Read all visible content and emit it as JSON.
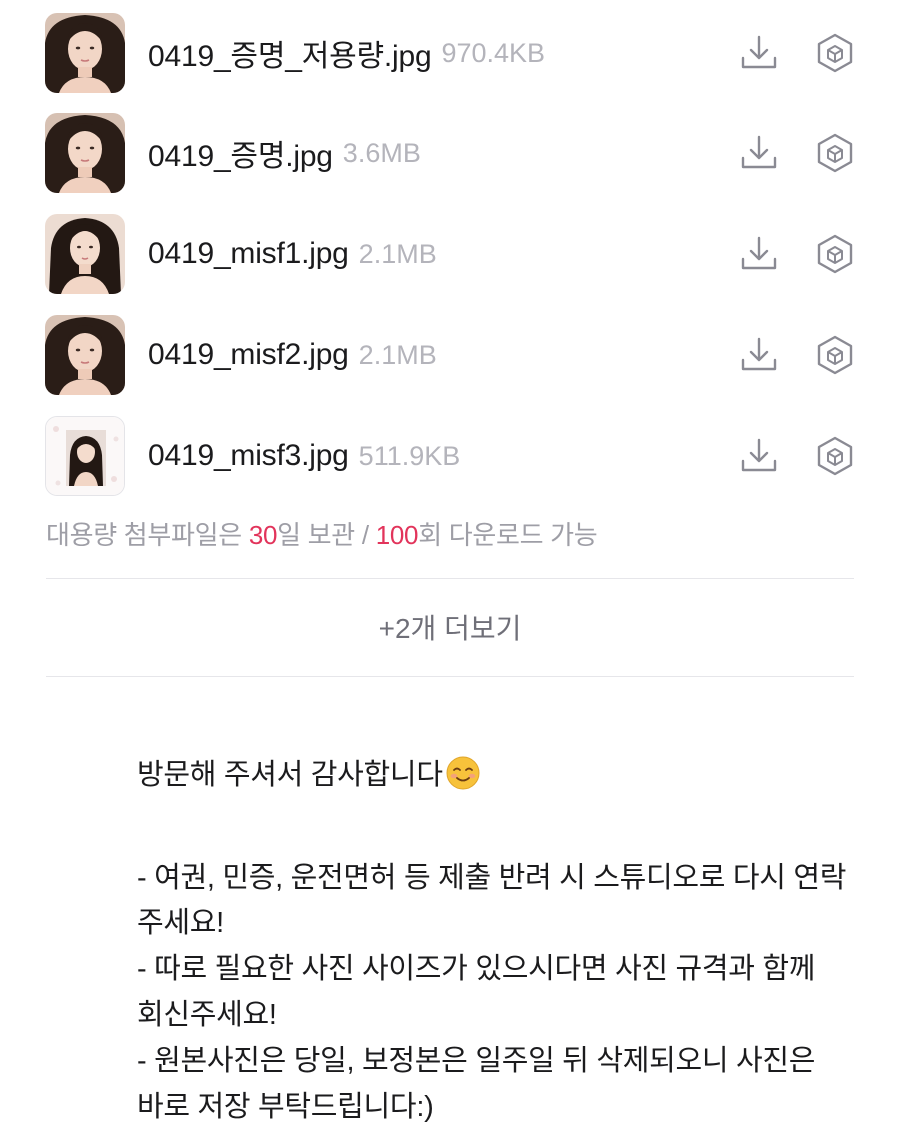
{
  "files": [
    {
      "name": "0419_증명_저용량.jpg",
      "size": "970.4KB",
      "thumb_style": "portrait-dark",
      "download_icon": "download-icon",
      "save_icon": "cube-icon"
    },
    {
      "name": "0419_증명.jpg",
      "size": "3.6MB",
      "thumb_style": "portrait-dark",
      "download_icon": "download-icon",
      "save_icon": "cube-icon"
    },
    {
      "name": "0419_misf1.jpg",
      "size": "2.1MB",
      "thumb_style": "portrait-light",
      "download_icon": "download-icon",
      "save_icon": "cube-icon"
    },
    {
      "name": "0419_misf2.jpg",
      "size": "2.1MB",
      "thumb_style": "portrait-dark",
      "download_icon": "download-icon",
      "save_icon": "cube-icon"
    },
    {
      "name": "0419_misf3.jpg",
      "size": "511.9KB",
      "thumb_style": "portrait-framed",
      "download_icon": "download-icon",
      "save_icon": "cube-icon"
    }
  ],
  "retention": {
    "prefix": "대용량 첨부파일은 ",
    "days": "30",
    "middle": "일 보관 / ",
    "downloads": "100",
    "suffix": "회 다운로드 가능"
  },
  "more_button": "+2개 더보기",
  "message": {
    "greeting": "방문해 주셔서 감사합니다",
    "greeting_emoji": "smiling-face-emoji",
    "lines": [
      "- 여권, 민증, 운전면허 등 제출 반려 시 스튜디오로 다시 연락",
      "주세요!",
      "- 따로 필요한 사진 사이즈가 있으시다면 사진 규격과 함께",
      "회신주세요!",
      "- 원본사진은 당일, 보정본은 일주일 뒤 삭제되오니 사진은",
      "바로 저장 부탁드립니다:)"
    ]
  },
  "colors": {
    "accent": "#e2345b",
    "icon_gray": "#8a8a93",
    "muted_text": "#9e9ea6"
  }
}
